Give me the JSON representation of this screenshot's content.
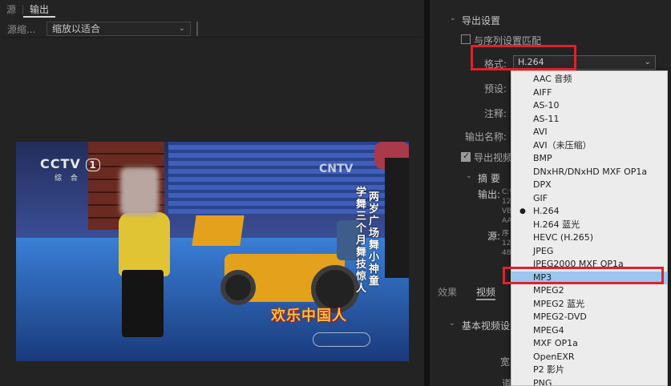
{
  "left_panel": {
    "tabs": [
      {
        "label": "源"
      },
      {
        "label": "输出"
      }
    ],
    "scale_label": "源缩...",
    "scale_value": "缩放以适合"
  },
  "video": {
    "logo_text": "CCTV",
    "logo_channel": "综  合",
    "logo_number": "1",
    "watermark": "CNTV",
    "caption_right": "两岁广场舞小神童",
    "caption_left": "学舞三个月舞技惊人",
    "show_title": "欢乐中国人"
  },
  "right_panel": {
    "section_title": "导出设置",
    "match_sequence_label": "与序列设置匹配",
    "format_label": "格式:",
    "format_value": "H.264",
    "preset_label": "预设:",
    "comment_label": "注释:",
    "output_name_label": "输出名称:",
    "export_video_label": "导出视频",
    "summary_label": "摘  要",
    "output_label": "输出:",
    "source_label": "源:",
    "summary_output_lines": [
      "C:\\",
      "128",
      "VB",
      "AA"
    ],
    "summary_source_lines": [
      "序",
      "128",
      "48"
    ],
    "bottom_tabs": [
      {
        "label": "效果"
      },
      {
        "label": "视频"
      }
    ],
    "basic_video_settings": "基本视频设置",
    "clip_width_char": "宽",
    "clip_char_2": "道"
  },
  "format_dropdown": {
    "selected": "H.264",
    "highlighted": "MP3",
    "options": [
      "AAC 音频",
      "AIFF",
      "AS-10",
      "AS-11",
      "AVI",
      "AVI（未压缩）",
      "BMP",
      "DNxHR/DNxHD MXF OP1a",
      "DPX",
      "GIF",
      "H.264",
      "H.264 蓝光",
      "HEVC (H.265)",
      "JPEG",
      "JPEG2000 MXF OP1a",
      "MP3",
      "MPEG2",
      "MPEG2 蓝光",
      "MPEG2-DVD",
      "MPEG4",
      "MXF OP1a",
      "OpenEXR",
      "P2 影片",
      "PNG"
    ]
  },
  "colors": {
    "panel_bg": "#232323",
    "annotation_red": "#e0202a",
    "highlight_blue": "#9bc6f1",
    "dropdown_bg": "#ececec"
  }
}
